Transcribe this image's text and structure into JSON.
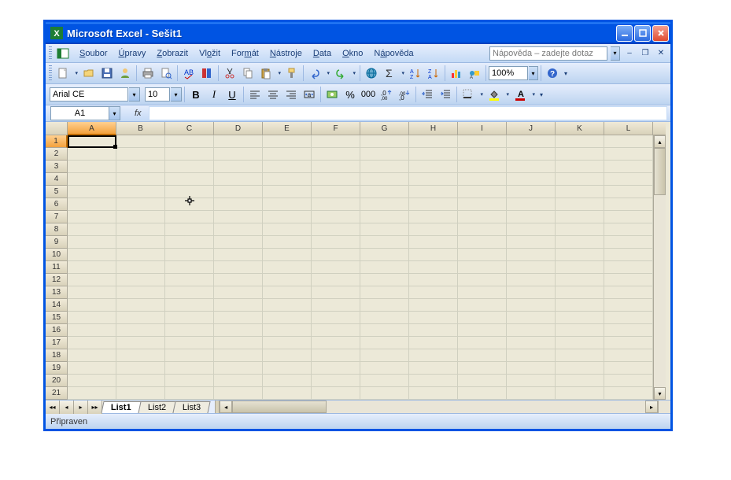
{
  "window": {
    "title": "Microsoft Excel - Sešit1"
  },
  "menu": {
    "items": [
      "Soubor",
      "Úpravy",
      "Zobrazit",
      "Vložit",
      "Formát",
      "Nástroje",
      "Data",
      "Okno",
      "Nápověda"
    ],
    "underline": [
      0,
      0,
      0,
      2,
      3,
      0,
      0,
      0,
      1
    ]
  },
  "help": {
    "placeholder": "Nápověda – zadejte dotaz"
  },
  "toolbar": {
    "zoom": "100%"
  },
  "format": {
    "font": "Arial CE",
    "size": "10"
  },
  "formula": {
    "name": "A1",
    "fx": "fx",
    "value": ""
  },
  "columns": [
    "A",
    "B",
    "C",
    "D",
    "E",
    "F",
    "G",
    "H",
    "I",
    "J",
    "K",
    "L"
  ],
  "rows": [
    "1",
    "2",
    "3",
    "4",
    "5",
    "6",
    "7",
    "8",
    "9",
    "10",
    "11",
    "12",
    "13",
    "14",
    "15",
    "16",
    "17",
    "18",
    "19",
    "20",
    "21"
  ],
  "active_cell": {
    "col": 0,
    "row": 0
  },
  "sheets": {
    "active": 0,
    "tabs": [
      "List1",
      "List2",
      "List3"
    ]
  },
  "status": "Připraven",
  "colors": {
    "accent": "#0054E3",
    "header_sel": "#f3a13c"
  }
}
